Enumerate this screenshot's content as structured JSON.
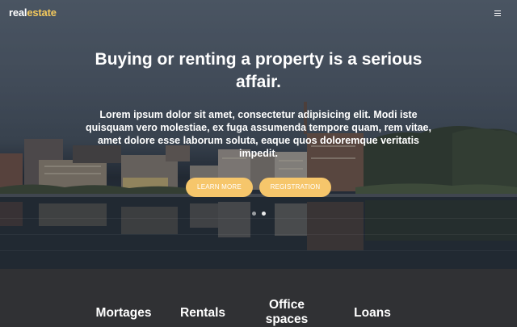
{
  "brand": {
    "part1": "real",
    "part2": "estate"
  },
  "nav": {
    "menu_icon": "hamburger-menu-icon"
  },
  "hero": {
    "headline": "Buying or renting a property is a serious affair.",
    "lead": "Lorem ipsum dolor sit amet, consectetur adipisicing elit. Modi iste quisquam vero molestiae, ex fuga assumenda tempore quam, rem vitae, amet dolore esse laborum soluta, eaque quos doloremque veritatis impedit.",
    "buttons": {
      "learn_more": "LEARN MORE",
      "registration": "REGISTRATION"
    },
    "slider": {
      "slide_count": 2,
      "active_index": 0
    }
  },
  "services": [
    "Mortages",
    "Rentals",
    "Office spaces",
    "Loans"
  ],
  "colors": {
    "accent": "#f6c66b",
    "brand_accent": "#f4c95d",
    "services_bg": "#303134"
  }
}
